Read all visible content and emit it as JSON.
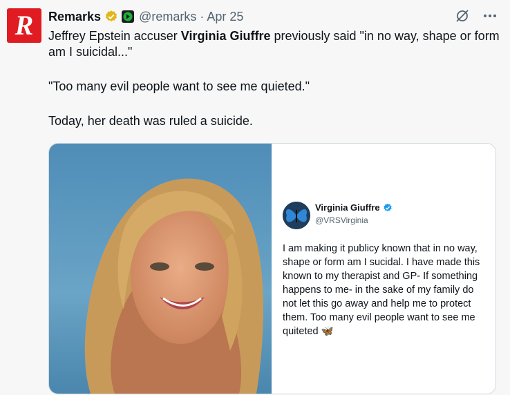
{
  "post": {
    "avatar_letter": "R",
    "display_name": "Remarks",
    "handle_date": "@remarks · Apr 25",
    "paragraphs": {
      "p1_before": "Jeffrey Epstein accuser ",
      "p1_bold": "Virginia Giuffre",
      "p1_after": " previously said \"in no way, shape or form am I suicidal...\"",
      "p2": "\"Too many evil people want to see me quieted.\"",
      "p3": "Today, her death was ruled a suicide."
    }
  },
  "embedded_tweet": {
    "name": "Virginia Giuffre",
    "handle": "@VRSVirginia",
    "text": "I am making it publicy known that in no way, shape or form am I sucidal. I have made this known to my therapist and GP- If something happens to me- in the sake of my family do not let this go away and help me to protect them. Too many evil people want to see me quiteted",
    "emoji": "🦋"
  },
  "icons": {
    "verified": "verified-gold-check-icon",
    "affiliate": "affiliate-badge-icon",
    "grok": "grok-icon",
    "more": "more-icon",
    "embedded_verified": "verified-blue-check-icon",
    "butterfly_avatar": "butterfly-avatar"
  },
  "colors": {
    "brand_red": "#e01b22",
    "gold": "#e2b719",
    "blue_check": "#1d9bf0",
    "secondary_text": "#536471",
    "border": "#cfd9de"
  }
}
